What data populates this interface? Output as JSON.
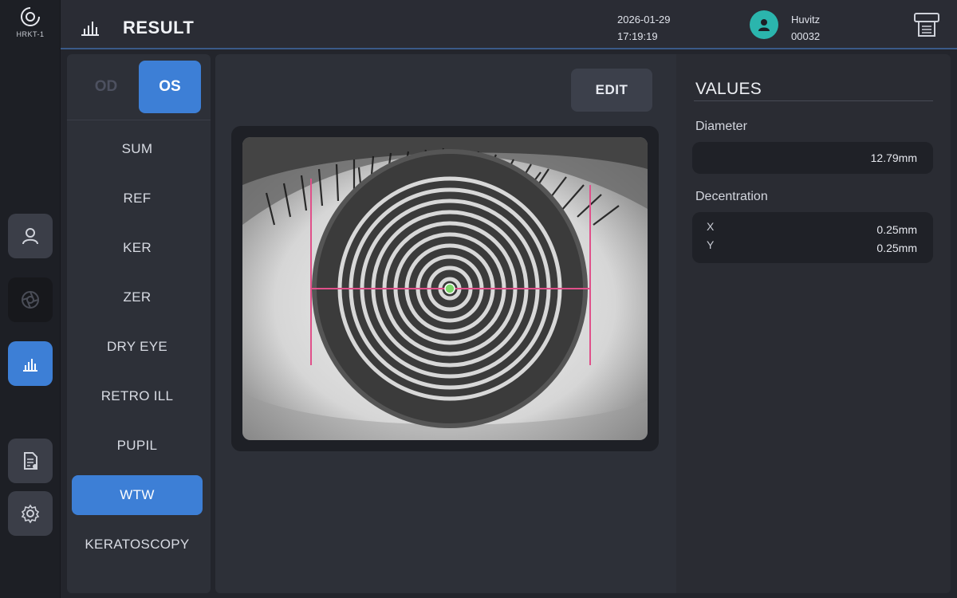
{
  "device": {
    "name": "HRKT-1"
  },
  "header": {
    "title": "RESULT",
    "date": "2026-01-29",
    "time": "17:19:19",
    "user_name": "Huvitz",
    "user_id": "00032"
  },
  "eye_toggle": {
    "od": "OD",
    "os": "OS",
    "selected": "OS"
  },
  "nav": {
    "items": [
      {
        "label": "SUM"
      },
      {
        "label": "REF"
      },
      {
        "label": "KER"
      },
      {
        "label": "ZER"
      },
      {
        "label": "DRY EYE"
      },
      {
        "label": "RETRO ILL"
      },
      {
        "label": "PUPIL"
      },
      {
        "label": "WTW"
      },
      {
        "label": "KERATOSCOPY"
      }
    ],
    "active": "WTW"
  },
  "toolbar": {
    "edit_label": "EDIT"
  },
  "values": {
    "title": "VALUES",
    "diameter_label": "Diameter",
    "diameter_value": "12.79mm",
    "decentration_label": "Decentration",
    "x_label": "X",
    "x_value": "0.25mm",
    "y_label": "Y",
    "y_value": "0.25mm"
  },
  "colors": {
    "accent": "#3d7fd6",
    "avatar": "#2bb5ad",
    "measure_line": "#e0508a",
    "center_dot": "#7dd66a"
  },
  "icons": {
    "device_logo": "device-logo-icon",
    "patient": "person-icon",
    "capture": "aperture-icon",
    "result": "bar-chart-icon",
    "report": "document-icon",
    "settings": "gear-icon",
    "print": "printer-icon"
  }
}
